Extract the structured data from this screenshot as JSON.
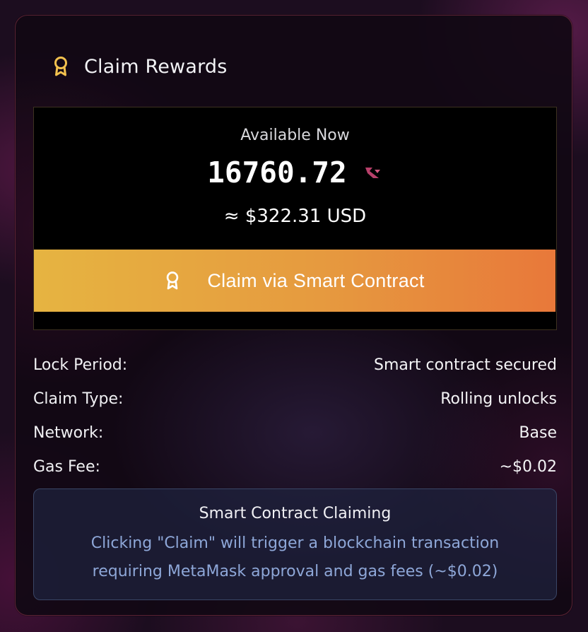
{
  "header": {
    "title": "Claim Rewards",
    "icon": "award-icon",
    "icon_color": "#f2c14e"
  },
  "rewards": {
    "available_label": "Available Now",
    "amount": "16760.72",
    "token_icon": "token-logo-icon",
    "usd_value": "≈ $322.31 USD"
  },
  "claim_button": {
    "label": "Claim via Smart Contract",
    "icon": "award-icon",
    "gradient_start": "#e6b441",
    "gradient_end": "#e8783a"
  },
  "details": [
    {
      "label": "Lock Period:",
      "value": "Smart contract secured"
    },
    {
      "label": "Claim Type:",
      "value": "Rolling unlocks"
    },
    {
      "label": "Network:",
      "value": "Base"
    },
    {
      "label": "Gas Fee:",
      "value": "~$0.02"
    }
  ],
  "info": {
    "title": "Smart Contract Claiming",
    "text": "Clicking \"Claim\" will trigger a blockchain transaction requiring MetaMask approval and gas fees (~$0.02)"
  }
}
